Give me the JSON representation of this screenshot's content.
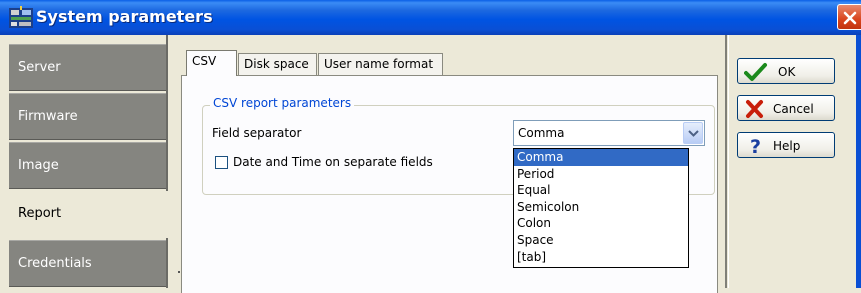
{
  "window": {
    "title": "System parameters",
    "icon": "network-settings-icon",
    "close_icon": "close-icon"
  },
  "sidebar": {
    "items": [
      {
        "label": "Server",
        "active": false
      },
      {
        "label": "Firmware",
        "active": false
      },
      {
        "label": "Image",
        "active": false
      },
      {
        "label": "Report",
        "active": true
      },
      {
        "label": "Credentials",
        "active": false
      }
    ]
  },
  "tabs": [
    {
      "label": "CSV",
      "selected": true
    },
    {
      "label": "Disk space",
      "selected": false
    },
    {
      "label": "User name format",
      "selected": false
    }
  ],
  "csv": {
    "group_title": "CSV report parameters",
    "field_separator_label": "Field separator",
    "field_separator_value": "Comma",
    "separator_options": [
      "Comma",
      "Period",
      "Equal",
      "Semicolon",
      "Colon",
      "Space",
      "[tab]"
    ],
    "highlighted_option": "Comma",
    "date_time_label": "Date and Time on separate fields",
    "date_time_checked": false
  },
  "buttons": {
    "ok": {
      "label": "OK",
      "icon": "checkmark-icon"
    },
    "cancel": {
      "label": "Cancel",
      "icon": "x-mark-icon"
    },
    "help": {
      "label": "Help",
      "icon": "question-mark-icon"
    }
  },
  "colors": {
    "titlebar": "#0054e3",
    "sidebar_inactive": "#858580",
    "group_title": "#0046d5",
    "selection": "#316ac5"
  }
}
